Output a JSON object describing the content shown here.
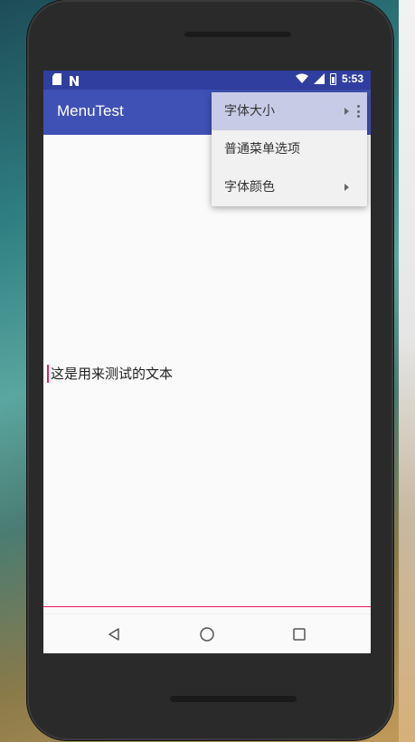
{
  "status_bar": {
    "time": "5:53",
    "icons": [
      "sd-card-icon",
      "n-notification-icon",
      "wifi-icon",
      "signal-icon",
      "battery-icon"
    ]
  },
  "app_bar": {
    "title": "MenuTest"
  },
  "popup_menu": {
    "items": [
      {
        "label": "字体大小",
        "has_submenu": true,
        "highlighted": true
      },
      {
        "label": "普通菜单选项",
        "has_submenu": false,
        "highlighted": false
      },
      {
        "label": "字体颜色",
        "has_submenu": true,
        "highlighted": false
      }
    ]
  },
  "content": {
    "text": "这是用来测试的文本"
  },
  "colors": {
    "primary": "#3f51b5",
    "primary_dark": "#303f9f",
    "accent": "#e91e63",
    "menu_highlight": "#c8cbe6"
  }
}
